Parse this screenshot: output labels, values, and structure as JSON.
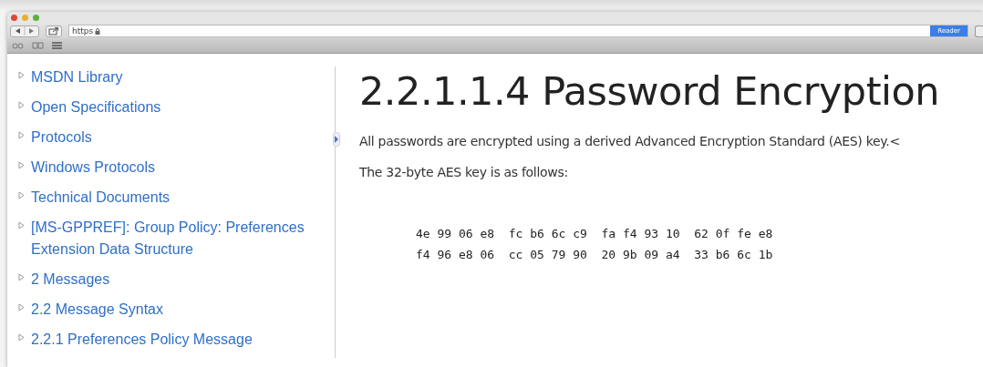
{
  "browser": {
    "address": "https",
    "reader_button": "Reader"
  },
  "sidebar": {
    "items": [
      {
        "label": "MSDN Library"
      },
      {
        "label": "Open Specifications"
      },
      {
        "label": "Protocols"
      },
      {
        "label": "Windows Protocols"
      },
      {
        "label": "Technical Documents"
      },
      {
        "label": "[MS-GPPREF]: Group Policy: Preferences Extension Data Structure"
      },
      {
        "label": "2 Messages"
      },
      {
        "label": "2.2 Message Syntax"
      },
      {
        "label": "2.2.1 Preferences Policy Message"
      }
    ]
  },
  "article": {
    "title": "2.2.1.1.4 Password Encryption",
    "paragraphs": [
      "All passwords are encrypted using a derived Advanced Encryption Standard (AES) key.<",
      "The 32-byte AES key is as follows:"
    ],
    "code_lines": [
      "4e 99 06 e8  fc b6 6c c9  fa f4 93 10  62 0f fe e8",
      "f4 96 e8 06  cc 05 79 90  20 9b 09 a4  33 b6 6c 1b"
    ]
  }
}
